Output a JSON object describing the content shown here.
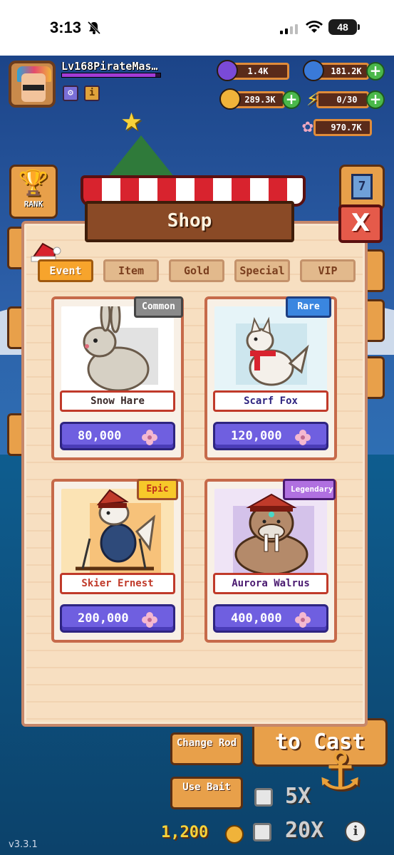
{
  "status_bar": {
    "time": "3:13",
    "battery": "48"
  },
  "hud": {
    "player_name": "Lv168PirateMas…",
    "xp_fraction": 0.95,
    "resources": {
      "pearls": "1.4K",
      "fish": "181.2K",
      "gold": "289.3K",
      "energy": "0/30",
      "gems": "970.7K"
    },
    "rank_label": "RANK",
    "calendar_day": "7"
  },
  "shop": {
    "title": "Shop",
    "close_label": "X",
    "tabs": [
      {
        "label": "Event",
        "active": true
      },
      {
        "label": "Item",
        "active": false
      },
      {
        "label": "Gold",
        "active": false
      },
      {
        "label": "Special",
        "active": false
      },
      {
        "label": "VIP",
        "active": false
      }
    ],
    "items": [
      {
        "name": "Snow Hare",
        "rarity": "Common",
        "price": "80,000"
      },
      {
        "name": "Scarf Fox",
        "rarity": "Rare",
        "price": "120,000"
      },
      {
        "name": "Skier Ernest",
        "rarity": "Epic",
        "price": "200,000"
      },
      {
        "name": "Aurora Walrus",
        "rarity": "Legendary",
        "price": "400,000"
      }
    ]
  },
  "controls": {
    "change_rod": "Change Rod",
    "use_bait": "Use Bait",
    "cast": "to Cast",
    "mult_5x": "5X",
    "mult_20x": "20X",
    "bait_cost": "1,200",
    "info": "i"
  },
  "version": "v3.3.1",
  "colors": {
    "accent_tab": "#f7a42c",
    "price_button": "#6f5fe0",
    "close_button": "#e55a4a"
  }
}
